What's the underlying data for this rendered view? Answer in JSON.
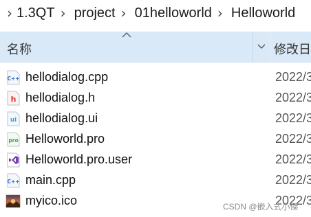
{
  "breadcrumb": [
    "1.3QT",
    "project",
    "01helloworld",
    "Helloworld"
  ],
  "header": {
    "name_col": "名称",
    "date_col": "修改日"
  },
  "files": [
    {
      "name": "hellodialog.cpp",
      "date": "2022/3",
      "icon": "cpp-file-icon"
    },
    {
      "name": "hellodialog.h",
      "date": "2022/3",
      "icon": "header-file-icon"
    },
    {
      "name": "hellodialog.ui",
      "date": "2022/3",
      "icon": "ui-file-icon"
    },
    {
      "name": "Helloworld.pro",
      "date": "2022/3",
      "icon": "pro-file-icon"
    },
    {
      "name": "Helloworld.pro.user",
      "date": "2022/3",
      "icon": "visual-studio-file-icon"
    },
    {
      "name": "main.cpp",
      "date": "2022/3",
      "icon": "cpp-file-icon"
    },
    {
      "name": "myico.ico",
      "date": "2022/3",
      "icon": "image-file-icon"
    }
  ],
  "watermark": "CSDN @嵌入式小傑",
  "colors": {
    "header_bg": "#d9e9f8",
    "cpp_icon": "#2e6fcf",
    "header_icon": "#d9382c",
    "ui_icon": "#3aa0d8",
    "pro_icon": "#41a146",
    "vs_icon": "#7b3fb3"
  }
}
